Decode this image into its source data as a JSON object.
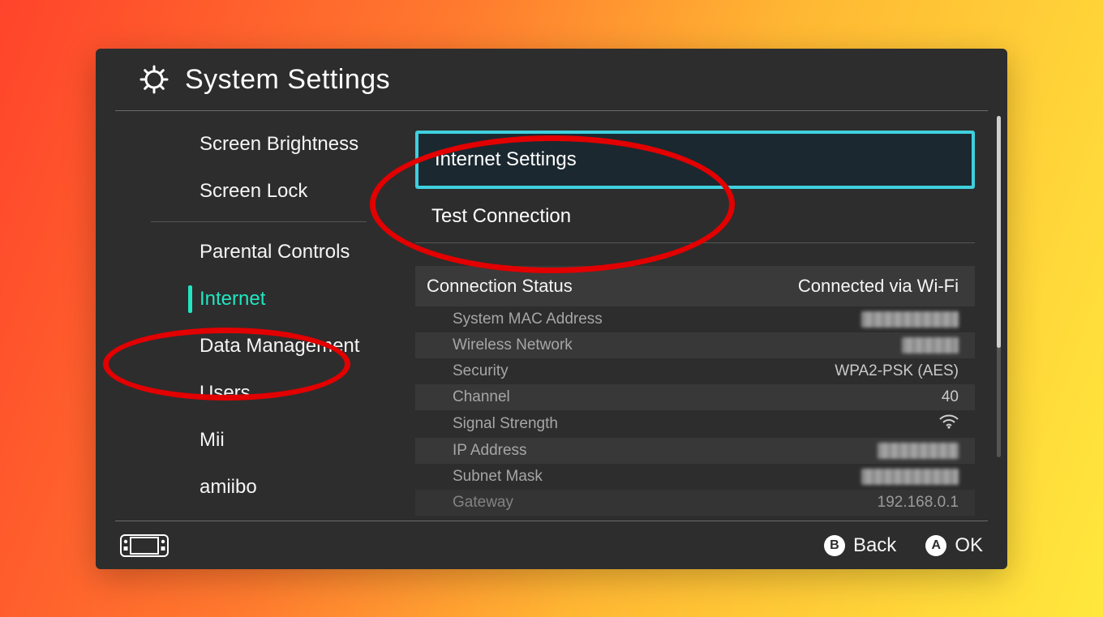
{
  "header": {
    "title": "System Settings"
  },
  "sidebar": {
    "items": [
      {
        "label": "Screen Brightness",
        "active": false,
        "group": 0
      },
      {
        "label": "Screen Lock",
        "active": false,
        "group": 0
      },
      {
        "label": "Parental Controls",
        "active": false,
        "group": 1
      },
      {
        "label": "Internet",
        "active": true,
        "group": 1
      },
      {
        "label": "Data Management",
        "active": false,
        "group": 1
      },
      {
        "label": "Users",
        "active": false,
        "group": 1
      },
      {
        "label": "Mii",
        "active": false,
        "group": 1
      },
      {
        "label": "amiibo",
        "active": false,
        "group": 1
      }
    ]
  },
  "content": {
    "options": [
      {
        "label": "Internet Settings",
        "selected": true
      },
      {
        "label": "Test Connection",
        "selected": false
      }
    ],
    "status": {
      "title": "Connection Status",
      "value": "Connected via Wi-Fi",
      "rows": [
        {
          "label": "System MAC Address",
          "value": null,
          "redacted": true
        },
        {
          "label": "Wireless Network",
          "value": null,
          "redacted": true
        },
        {
          "label": "Security",
          "value": "WPA2-PSK (AES)",
          "redacted": false
        },
        {
          "label": "Channel",
          "value": "40",
          "redacted": false
        },
        {
          "label": "Signal Strength",
          "value": "wifi-icon",
          "redacted": false,
          "icon": true
        },
        {
          "label": "IP Address",
          "value": null,
          "redacted": true
        },
        {
          "label": "Subnet Mask",
          "value": null,
          "redacted": true
        },
        {
          "label": "Gateway",
          "value": "192.168.0.1",
          "redacted": false
        }
      ]
    }
  },
  "footer": {
    "back_glyph": "B",
    "back_label": "Back",
    "ok_glyph": "A",
    "ok_label": "OK"
  },
  "annotations": [
    {
      "target": "sidebar-internet"
    },
    {
      "target": "internet-settings"
    }
  ]
}
